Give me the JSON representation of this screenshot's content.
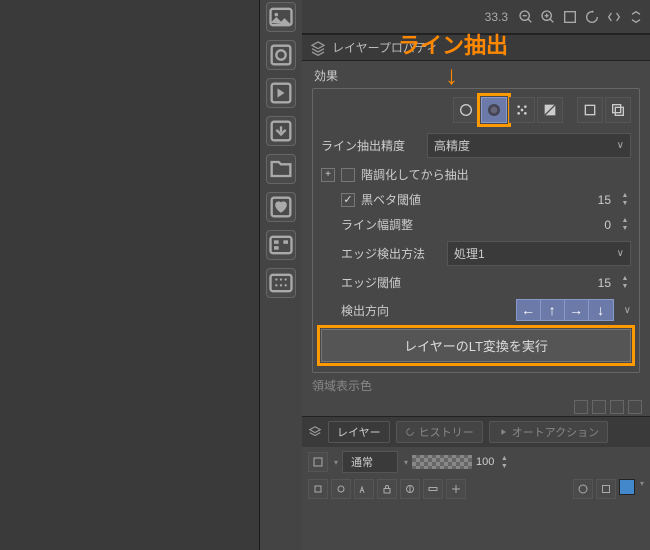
{
  "top": {
    "value": "33.3"
  },
  "annotation": {
    "label": "ライン抽出",
    "arrow": "↓"
  },
  "panel": {
    "title": "レイヤープロパティ"
  },
  "effects": {
    "label": "効果",
    "precision_label": "ライン抽出精度",
    "precision_value": "高精度",
    "posterize_label": "階調化してから抽出",
    "black_threshold_label": "黒ベタ閾値",
    "black_threshold_value": "15",
    "line_width_label": "ライン幅調整",
    "line_width_value": "0",
    "edge_method_label": "エッジ検出方法",
    "edge_method_value": "処理1",
    "edge_threshold_label": "エッジ閾値",
    "edge_threshold_value": "15",
    "direction_label": "検出方向",
    "execute_label": "レイヤーのLT変換を実行"
  },
  "truncated": "領域表示色",
  "layers": {
    "tab1": "レイヤー",
    "tab2": "ヒストリー",
    "tab3": "オートアクション",
    "mode": "通常",
    "opacity": "100"
  }
}
